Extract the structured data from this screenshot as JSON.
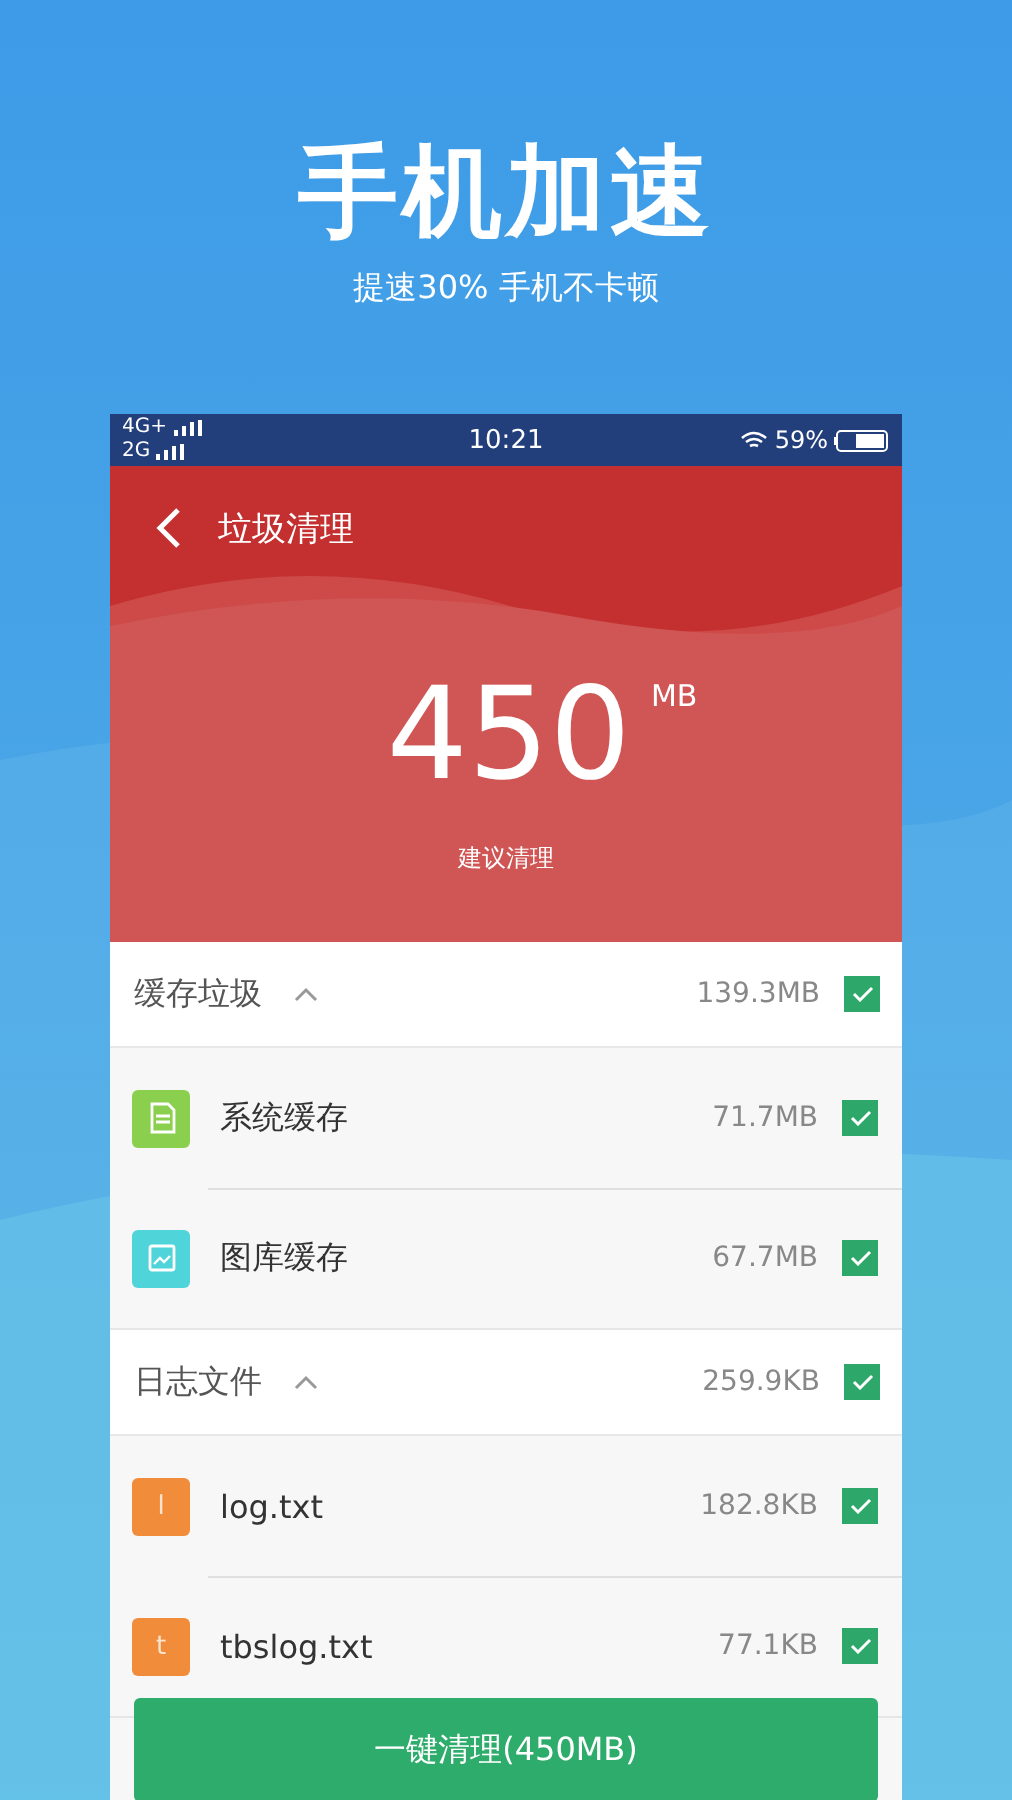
{
  "promo": {
    "title": "手机加速",
    "subtitle": "提速30% 手机不卡顿"
  },
  "status_bar": {
    "network_1": "4G+",
    "network_2": "2G",
    "time": "10:21",
    "battery": "59%"
  },
  "header": {
    "title": "垃圾清理",
    "size": "450",
    "unit": "MB",
    "caption": "建议清理"
  },
  "groups": [
    {
      "name": "缓存垃圾",
      "size": "139.3MB",
      "expanded": true,
      "checked": true,
      "items": [
        {
          "kind": "app",
          "name": "系统缓存",
          "size": "71.7MB",
          "color": "#8bcf4f",
          "checked": true
        },
        {
          "kind": "gallery",
          "name": "图库缓存",
          "size": "67.7MB",
          "color": "#4fd5d9",
          "checked": true
        }
      ]
    },
    {
      "name": "日志文件",
      "size": "259.9KB",
      "expanded": true,
      "checked": true,
      "items": [
        {
          "kind": "letter",
          "letter": "l",
          "name": "log.txt",
          "size": "182.8KB",
          "color": "#f08c3a",
          "checked": true
        },
        {
          "kind": "letter",
          "letter": "t",
          "name": "tbslog.txt",
          "size": "77.1KB",
          "color": "#f08c3a",
          "checked": true
        }
      ]
    }
  ],
  "clean_button": "一键清理(450MB)"
}
